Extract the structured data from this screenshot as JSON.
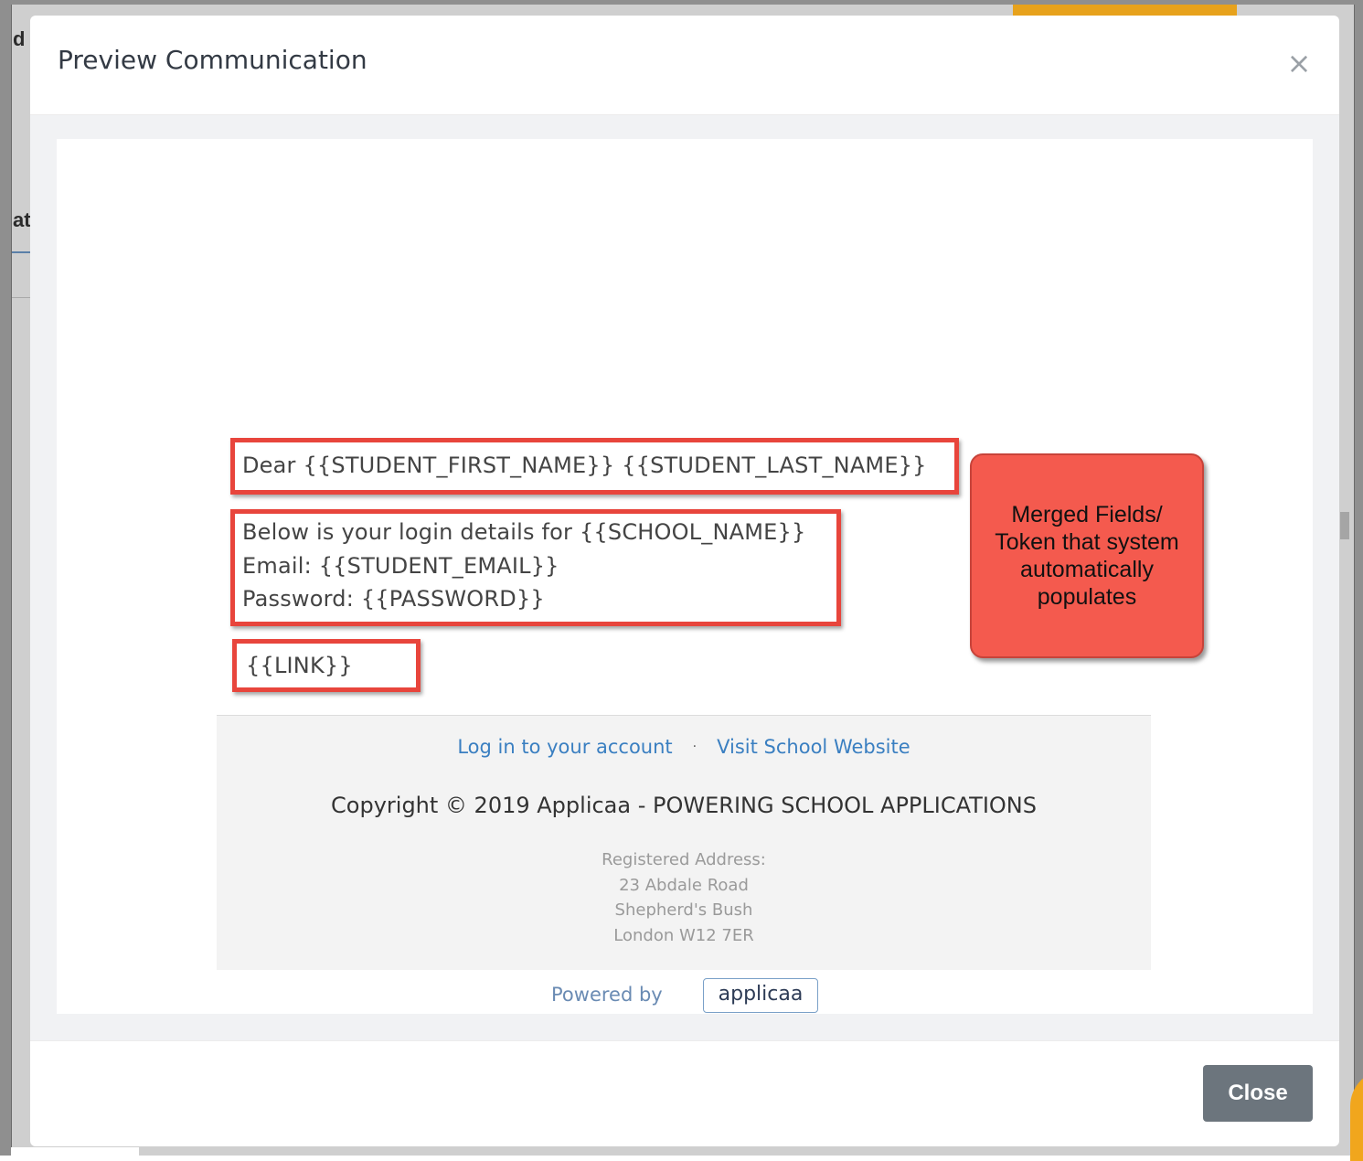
{
  "background": {
    "peek_text_1": "d",
    "peek_text_2": "at"
  },
  "modal": {
    "title": "Preview Communication",
    "close_icon": "×",
    "close_button_label": "Close"
  },
  "email": {
    "greeting_line": "Dear {{STUDENT_FIRST_NAME}}  {{STUDENT_LAST_NAME}}",
    "details_line_1": "Below is your login details for {{SCHOOL_NAME}}",
    "details_line_2": "Email: {{STUDENT_EMAIL}}",
    "details_line_3": "Password: {{PASSWORD}}",
    "link_line": "{{LINK}}"
  },
  "callout": {
    "text": "Merged Fields/ Token that system automatically populates"
  },
  "footer": {
    "login_link": "Log in to your account",
    "separator": "·",
    "website_link": "Visit School Website",
    "copyright": "Copyright © 2019 Applicaa - POWERING SCHOOL APPLICATIONS",
    "address_label": "Registered Address:",
    "address_line_1": "23 Abdale Road",
    "address_line_2": "Shepherd's Bush",
    "address_line_3": "London W12 7ER",
    "powered_by": "Powered by",
    "brand": "applicaa"
  },
  "colors": {
    "highlight_border": "#e8453c",
    "callout_bg": "#f45a4e",
    "link": "#3a7fc1",
    "close_button_bg": "#6c757d"
  }
}
